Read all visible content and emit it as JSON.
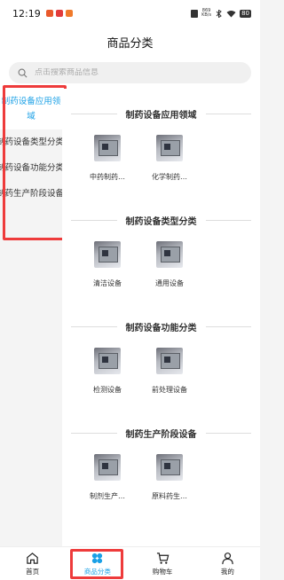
{
  "status_bar": {
    "time": "12:19",
    "network_speed": "869\nKB/s",
    "battery": "80"
  },
  "header": {
    "title": "商品分类"
  },
  "search": {
    "placeholder": "点击搜索商品信息"
  },
  "sidebar": {
    "items": [
      {
        "label": "制药设备应用领域",
        "active": true
      },
      {
        "label": "制药设备类型分类",
        "active": false
      },
      {
        "label": "制药设备功能分类",
        "active": false
      },
      {
        "label": "制药生产阶段设备",
        "active": false
      }
    ]
  },
  "sections": [
    {
      "title": "制药设备应用领域",
      "products": [
        {
          "name": "中药制药…"
        },
        {
          "name": "化学制药…"
        }
      ]
    },
    {
      "title": "制药设备类型分类",
      "products": [
        {
          "name": "清洁设备"
        },
        {
          "name": "通用设备"
        }
      ]
    },
    {
      "title": "制药设备功能分类",
      "products": [
        {
          "name": "检测设备"
        },
        {
          "name": "前处理设备"
        }
      ]
    },
    {
      "title": "制药生产阶段设备",
      "products": [
        {
          "name": "制剂生产…"
        },
        {
          "name": "原料药生…"
        }
      ]
    }
  ],
  "tabbar": {
    "items": [
      {
        "label": "首页",
        "icon": "home-icon"
      },
      {
        "label": "商品分类",
        "icon": "category-icon",
        "active": true
      },
      {
        "label": "购物车",
        "icon": "cart-icon"
      },
      {
        "label": "我的",
        "icon": "user-icon"
      }
    ]
  },
  "colors": {
    "accent": "#1aa0e6",
    "highlight": "#ee3b3b"
  }
}
